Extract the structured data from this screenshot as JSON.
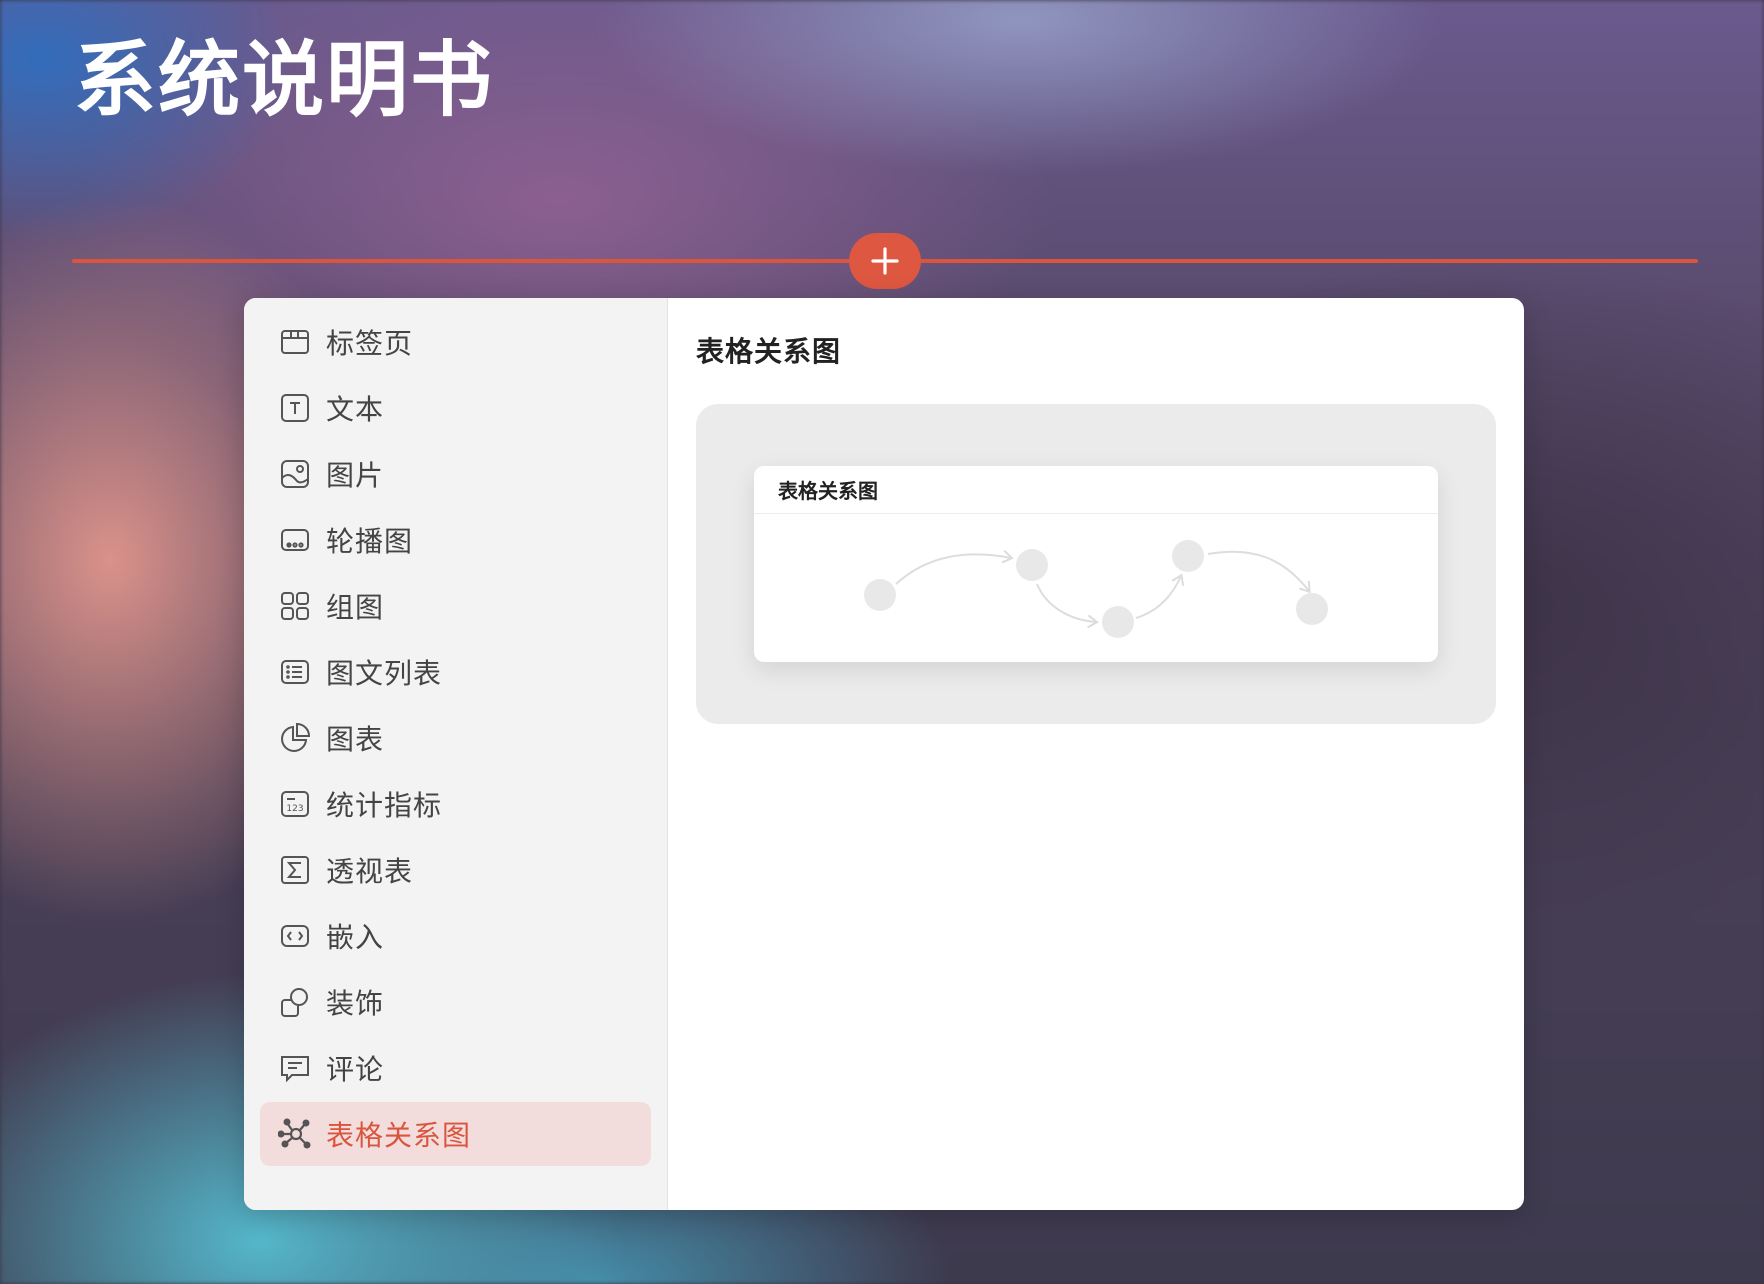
{
  "page": {
    "title": "系统说明书"
  },
  "toolbar": {
    "add_icon": "plus-icon"
  },
  "sidebar": {
    "items": [
      {
        "label": "标签页",
        "icon": "tab-page-icon"
      },
      {
        "label": "文本",
        "icon": "text-icon"
      },
      {
        "label": "图片",
        "icon": "image-icon"
      },
      {
        "label": "轮播图",
        "icon": "carousel-icon"
      },
      {
        "label": "组图",
        "icon": "image-grid-icon"
      },
      {
        "label": "图文列表",
        "icon": "list-icon"
      },
      {
        "label": "图表",
        "icon": "pie-chart-icon"
      },
      {
        "label": "统计指标",
        "icon": "stat-number-icon"
      },
      {
        "label": "透视表",
        "icon": "sigma-icon"
      },
      {
        "label": "嵌入",
        "icon": "code-embed-icon"
      },
      {
        "label": "装饰",
        "icon": "shapes-icon"
      },
      {
        "label": "评论",
        "icon": "comment-icon"
      },
      {
        "label": "表格关系图",
        "icon": "relation-graph-icon",
        "active": true
      }
    ]
  },
  "content": {
    "title": "表格关系图",
    "preview": {
      "title": "表格关系图"
    }
  },
  "colors": {
    "accent": "#d9553e",
    "active_bg": "#f2dddc"
  }
}
